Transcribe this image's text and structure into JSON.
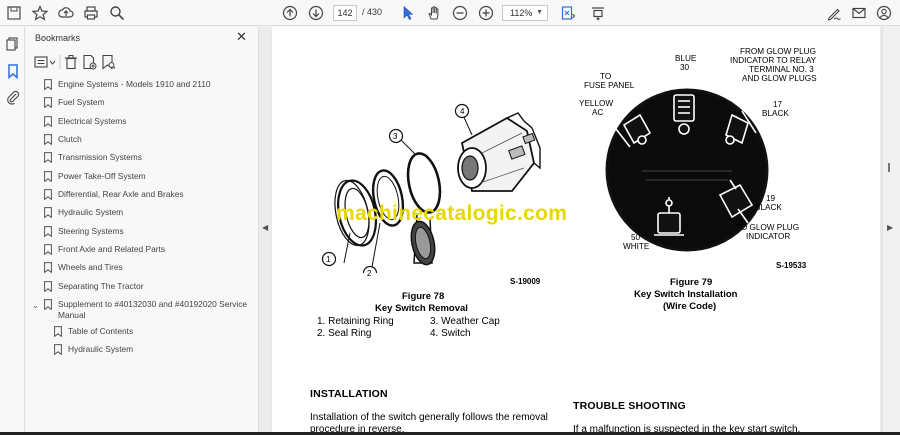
{
  "toolbar": {
    "page_current": "142",
    "page_total": "/ 430",
    "zoom": "112%"
  },
  "panel": {
    "title": "Bookmarks",
    "close": "✕"
  },
  "bookmarks": [
    {
      "label": "Engine Systems - Models 1910 and 2110"
    },
    {
      "label": "Fuel System"
    },
    {
      "label": "Electrical Systems"
    },
    {
      "label": "Clutch"
    },
    {
      "label": "Transmission Systems"
    },
    {
      "label": "Power Take-Off System"
    },
    {
      "label": "Differential, Rear Axle and Brakes"
    },
    {
      "label": "Hydraulic System"
    },
    {
      "label": "Steering Systems"
    },
    {
      "label": "Front Axle and Related Parts"
    },
    {
      "label": "Wheels and Tires"
    },
    {
      "label": "Separating The Tractor"
    },
    {
      "label": "Supplement to #40132030 and #40192020 Service Manual",
      "expanded": true
    },
    {
      "label": "Table of Contents",
      "child": true
    },
    {
      "label": "Hydraulic System",
      "child": true
    }
  ],
  "document": {
    "watermark": "machinecatalogic.com",
    "fig78": {
      "callouts": [
        "1",
        "2",
        "3",
        "4"
      ],
      "code": "S-19009",
      "caption_num": "Figure 78",
      "caption_title": "Key Switch Removal",
      "legend": [
        "1.  Retaining Ring",
        "2.  Seal Ring",
        "3.  Weather Cap",
        "4.  Switch"
      ]
    },
    "fig79": {
      "labels": {
        "blue": [
          "BLUE",
          "30"
        ],
        "glow_relay": [
          "FROM GLOW PLUG",
          "INDICATOR TO RELAY",
          "TERMINAL NO. 3",
          "AND GLOW PLUGS"
        ],
        "fuse": [
          "TO",
          "FUSE PANEL"
        ],
        "yellow": [
          "YELLOW",
          "AC"
        ],
        "black17": [
          "17",
          "BLACK"
        ],
        "black19": [
          "19",
          "BLACK"
        ],
        "white50": [
          "50",
          "WHITE"
        ],
        "glow_ind": [
          "TO GLOW PLUG",
          "INDICATOR"
        ]
      },
      "code": "S-19533",
      "caption_num": "Figure 79",
      "caption_title": "Key Switch Installation",
      "caption_sub": "(Wire Code)"
    },
    "installation_heading": "INSTALLATION",
    "installation_line1": "Installation of the switch generally follows the removal",
    "installation_line2": "procedure in reverse.",
    "trouble_heading": "TROUBLE SHOOTING",
    "trouble_line1": "If a malfunction is suspected in the key start switch,"
  },
  "colors": {
    "watermark": "#e6d800",
    "toolbar_bg": "#f8f8f8",
    "doc_bg": "#e9e9e9",
    "page_bg": "#ffffff"
  }
}
